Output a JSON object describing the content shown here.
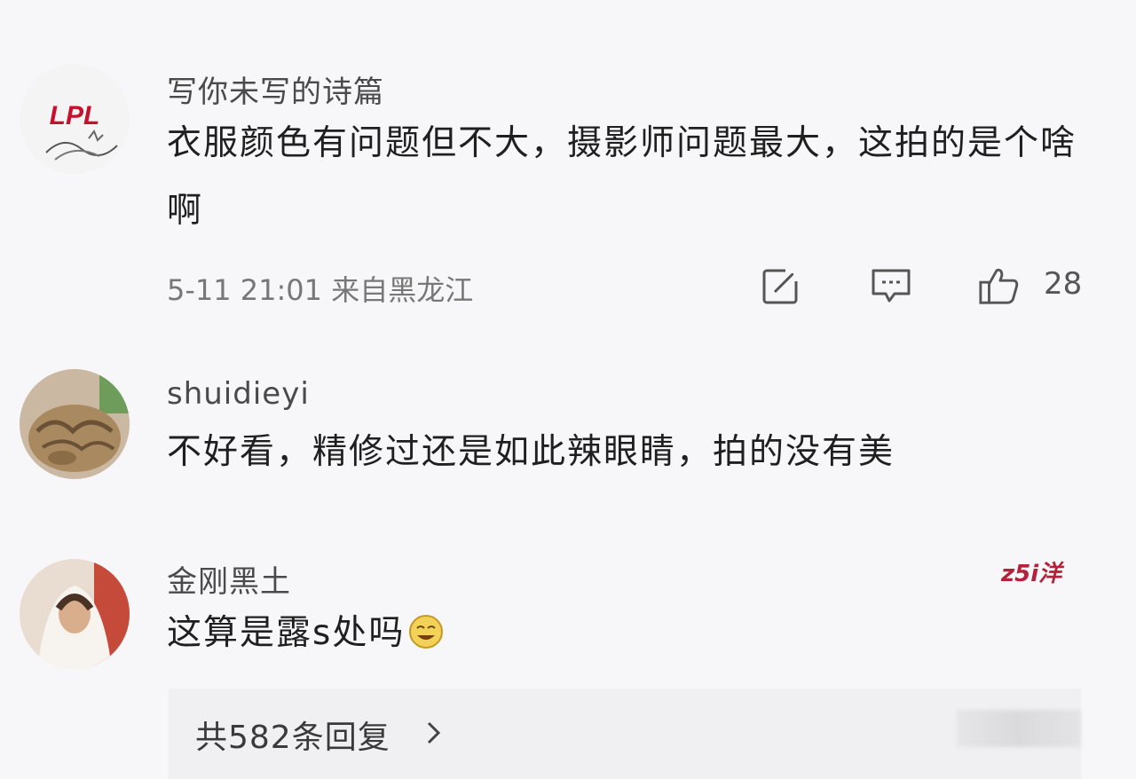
{
  "comments": [
    {
      "username": "写你未写的诗篇",
      "avatar_text": "LPL",
      "text": "衣服颜色有问题但不大，摄影师问题最大，这拍的是个啥啊",
      "meta": "5-11 21:01 来自黑龙江",
      "likes": "28",
      "icons": [
        "share-icon",
        "comment-icon",
        "like-icon"
      ]
    },
    {
      "username": "shuidieyi",
      "text": "不好看，精修过还是如此辣眼睛，拍的没有美"
    },
    {
      "username": "金刚黑土",
      "badge": "z5i洋",
      "text": "这算是露s处吗",
      "emoji": "laughing-emoji"
    }
  ],
  "replies": {
    "label": "共582条回复"
  },
  "colors": {
    "background": "#f7f7f9",
    "lpl_red": "#c8102e",
    "badge": "#b3213a"
  }
}
